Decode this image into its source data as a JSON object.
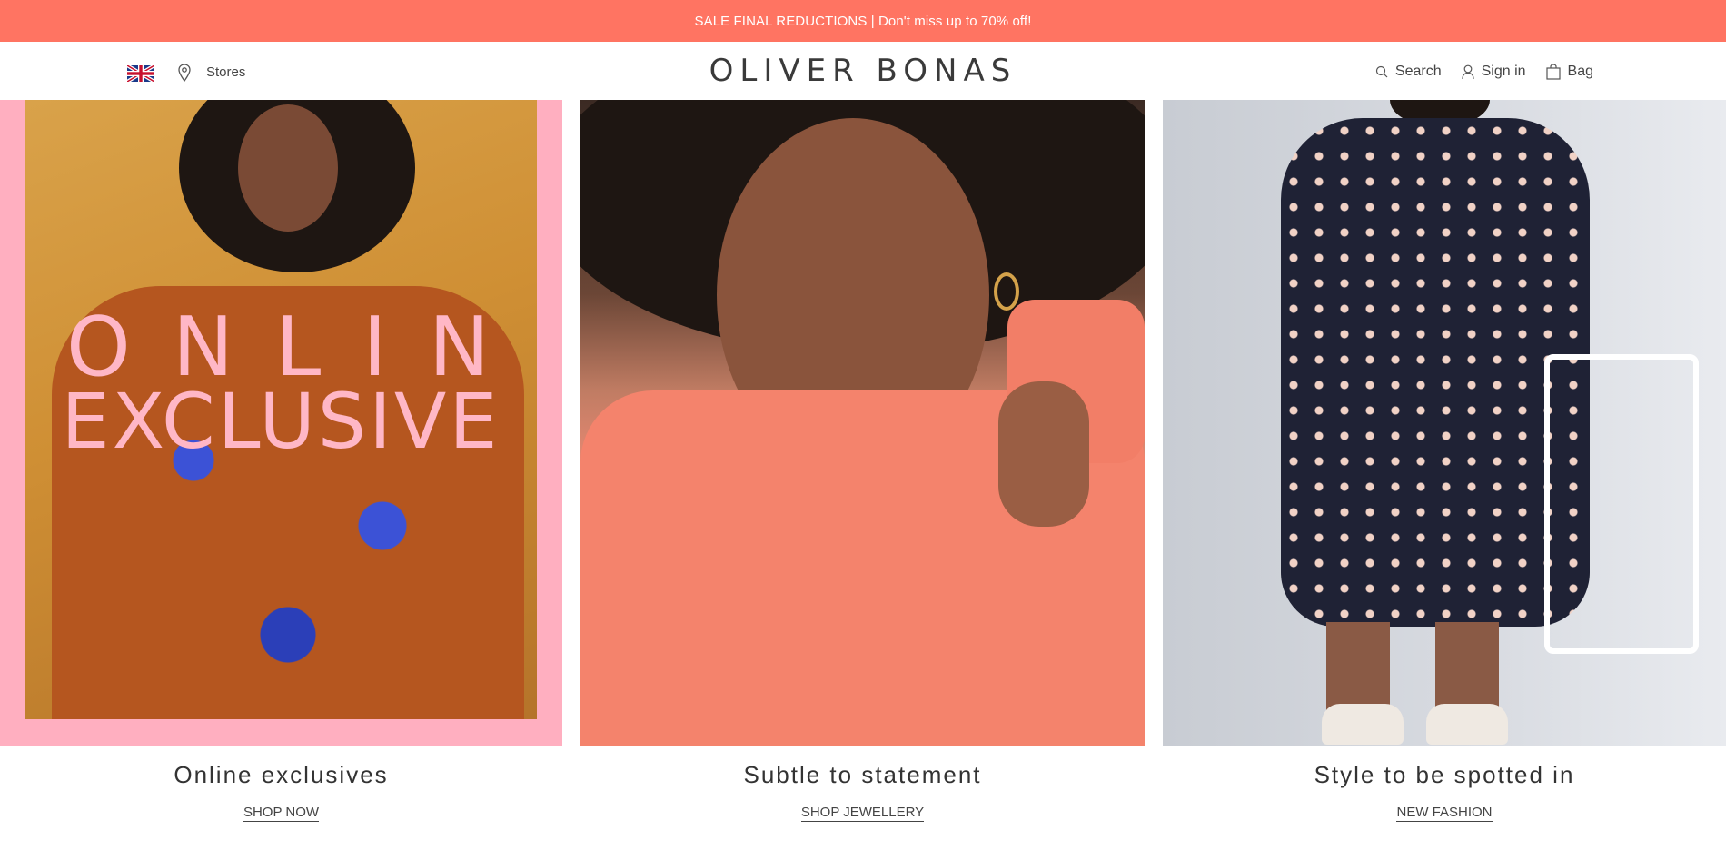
{
  "promo": {
    "text": "SALE FINAL REDUCTIONS | Don't miss up to 70% off!"
  },
  "header": {
    "country_flag": "uk-flag-icon",
    "stores_label": "Stores",
    "logo": "OLIVER BONAS",
    "search_label": "Search",
    "signin_label": "Sign in",
    "bag_label": "Bag"
  },
  "tiles": [
    {
      "overlay_line1": "ONLINE",
      "overlay_line2": "EXCLUSIVE",
      "caption": "Online exclusives",
      "cta": "SHOP NOW"
    },
    {
      "caption": "Subtle to statement",
      "cta": "SHOP JEWELLERY"
    },
    {
      "caption": "Style to be spotted in",
      "cta": "NEW FASHION"
    }
  ],
  "colors": {
    "promo_bg": "#ff7462",
    "tile1_frame": "#ffafc0",
    "overlay_text": "#ffb7c6"
  }
}
